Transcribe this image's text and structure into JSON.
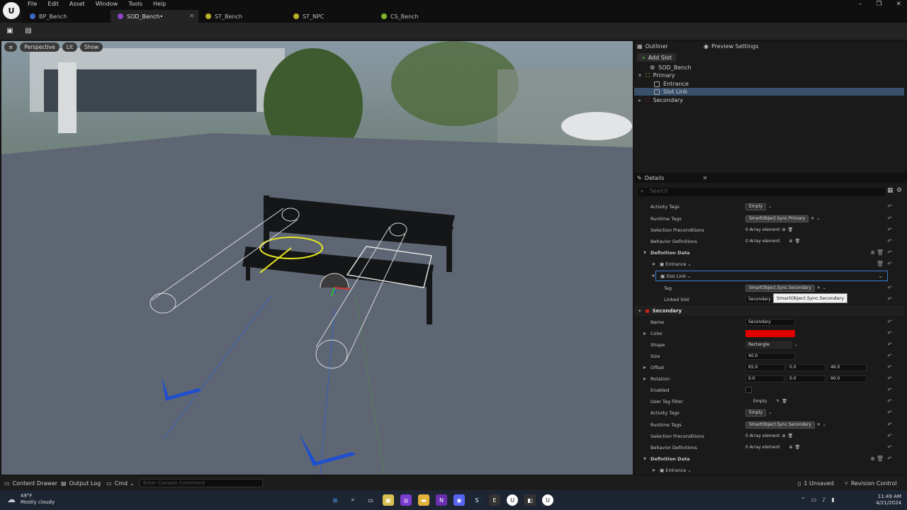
{
  "menu": [
    "File",
    "Edit",
    "Asset",
    "Window",
    "Tools",
    "Help"
  ],
  "tabs": [
    {
      "label": "BP_Bench",
      "color": "#3b68c7"
    },
    {
      "label": "SOD_Bench•",
      "color": "#8d46c9"
    },
    {
      "label": "ST_Bench",
      "color": "#b6b22a"
    },
    {
      "label": "ST_NPC",
      "color": "#b6b22a"
    },
    {
      "label": "CS_Bench",
      "color": "#7fb62a"
    }
  ],
  "viewport": {
    "perspective": "Perspective",
    "lit": "Lit",
    "show": "Show"
  },
  "outliner": {
    "tab": "Outliner",
    "preview_tab": "Preview Settings",
    "add_slot": "Add Slot",
    "items": [
      "SOD_Bench",
      "Primary",
      "Entrance",
      "Slot Link",
      "Secondary"
    ]
  },
  "details": {
    "tab": "Details",
    "search_placeholder": "Search",
    "rows1": [
      {
        "label": "Activity Tags",
        "value": "Empty"
      },
      {
        "label": "Runtime Tags",
        "value": "SmartObject.Sync.Primary"
      },
      {
        "label": "Selection Preconditions",
        "value": "0 Array element"
      },
      {
        "label": "Behavior Definitions",
        "value": "0 Array element"
      }
    ],
    "definition_data": "Definition Data",
    "entrance": "Entrance",
    "slot_link": "Slot Link",
    "tag_label": "Tag",
    "tag_value": "SmartObject.Sync.Secondary",
    "linked_label": "Linked Slot",
    "linked_value": "Secondary",
    "tooltip": "SmartObject.Sync.Secondary",
    "secondary": "Secondary",
    "name_label": "Name",
    "name_value": "Secondary",
    "color_label": "Color",
    "shape_label": "Shape",
    "shape_value": "Rectangle",
    "size_label": "Size",
    "size_value": "40.0",
    "offset_label": "Offset",
    "offset": [
      "65.0",
      "0.0",
      "46.0"
    ],
    "rotation_label": "Rotation",
    "rotation": [
      "0.0",
      "0.0",
      "90.0"
    ],
    "enabled_label": "Enabled",
    "user_tag_filter": "User Tag Filter",
    "empty": "Empty",
    "activity_tags": "Activity Tags",
    "runtime_tags": "Runtime Tags",
    "runtime_value2": "SmartObject.Sync.Secondary",
    "selection_pre": "Selection Preconditions",
    "array0": "0 Array element",
    "behavior_def": "Behavior Definitions",
    "definition_data2": "Definition Data",
    "entrance2": "Entrance"
  },
  "status": {
    "content_drawer": "Content Drawer",
    "output_log": "Output Log",
    "cmd": "Cmd",
    "console_placeholder": "Enter Console Command",
    "unsaved": "1 Unsaved",
    "revision": "Revision Control"
  },
  "taskbar": {
    "temp": "49°F",
    "weather": "Mostly cloudy",
    "time": "11:49 AM",
    "date": "4/21/2024"
  },
  "colors": {
    "secondary_color": "#e00000",
    "selection": "#38506a"
  }
}
